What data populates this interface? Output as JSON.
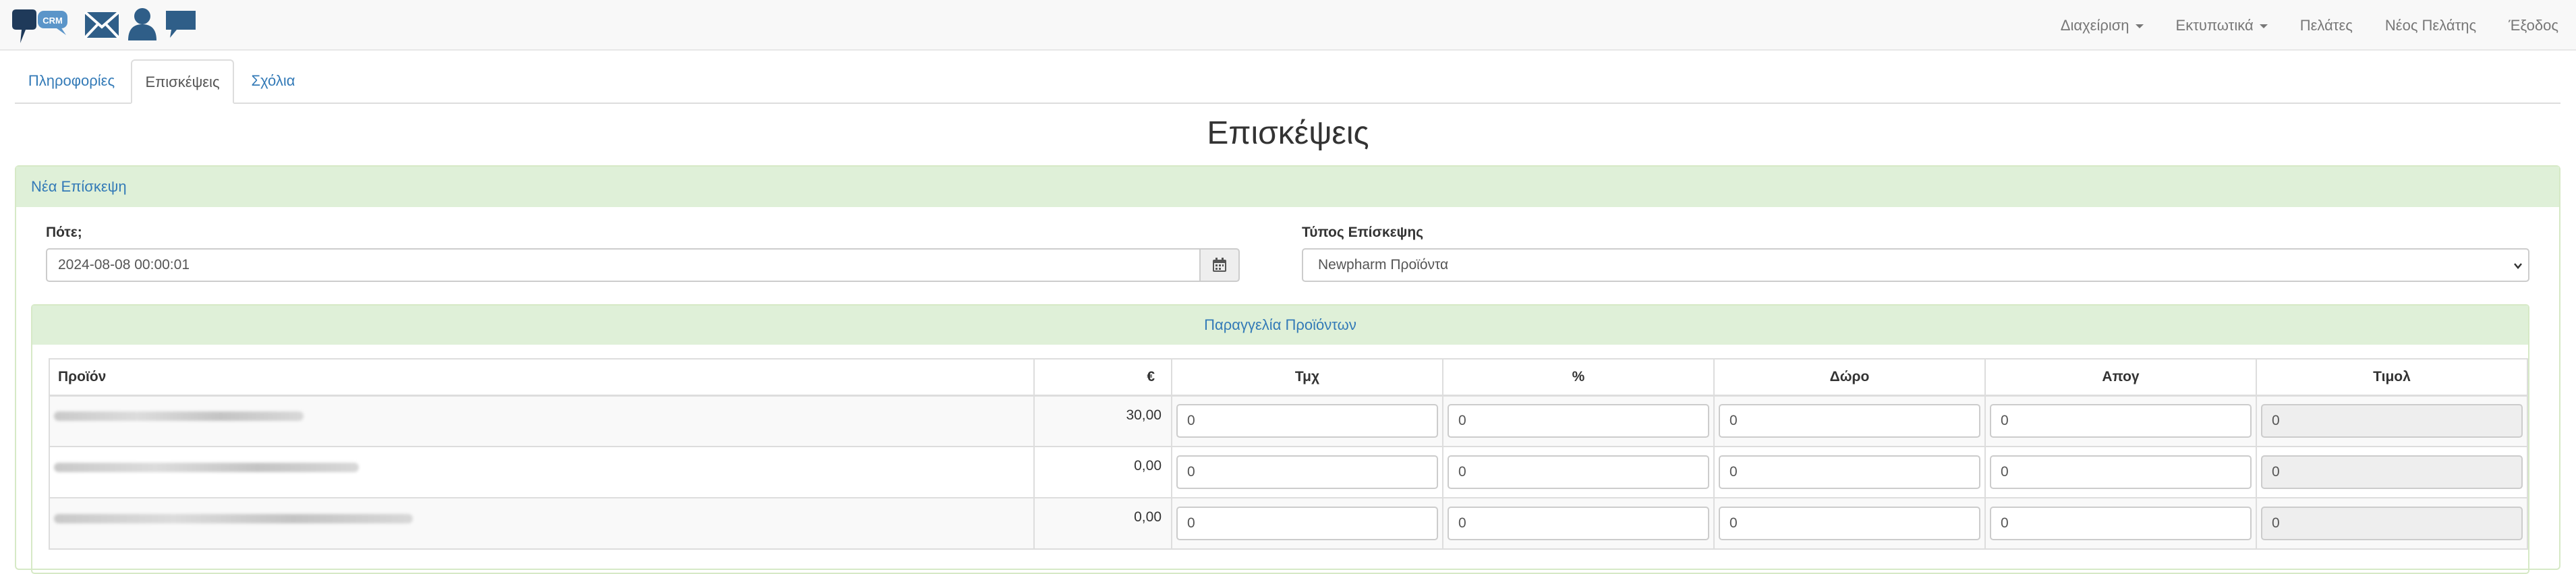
{
  "navbar": {
    "logo_text": "CRM",
    "menu": [
      {
        "label": "Διαχείριση",
        "dropdown": true
      },
      {
        "label": "Εκτυπωτικά",
        "dropdown": true
      },
      {
        "label": "Πελάτες",
        "dropdown": false
      },
      {
        "label": "Νέος Πελάτης",
        "dropdown": false
      },
      {
        "label": "Έξοδος",
        "dropdown": false
      }
    ]
  },
  "tabs": [
    {
      "label": "Πληροφορίες",
      "active": false
    },
    {
      "label": "Επισκέψεις",
      "active": true
    },
    {
      "label": "Σχόλια",
      "active": false
    }
  ],
  "page_title": "Επισκέψεις",
  "panel": {
    "heading": "Νέα Επίσκεψη",
    "when_label": "Πότε;",
    "when_value": "2024-08-08 00:00:01",
    "type_label": "Τύπος Επίσκεψης",
    "type_value": "Newpharm Προϊόντα",
    "order": {
      "heading": "Παραγγελία Προϊόντων",
      "columns": [
        "Προϊόν",
        "€",
        "Τμχ",
        "%",
        "Δώρο",
        "Απογ",
        "Τιμολ"
      ],
      "rows": [
        {
          "price": "30,00",
          "qty": "0",
          "pct": "0",
          "gift": "0",
          "stock": "0",
          "invoice": "0"
        },
        {
          "price": "0,00",
          "qty": "0",
          "pct": "0",
          "gift": "0",
          "stock": "0",
          "invoice": "0"
        },
        {
          "price": "0,00",
          "qty": "0",
          "pct": "0",
          "gift": "0",
          "stock": "0",
          "invoice": "0"
        }
      ]
    }
  },
  "colors": {
    "link": "#337ab7",
    "panel_heading_bg": "#dff0d8",
    "logo_dark": "#1f3a5a",
    "logo_light": "#5b95c9"
  }
}
